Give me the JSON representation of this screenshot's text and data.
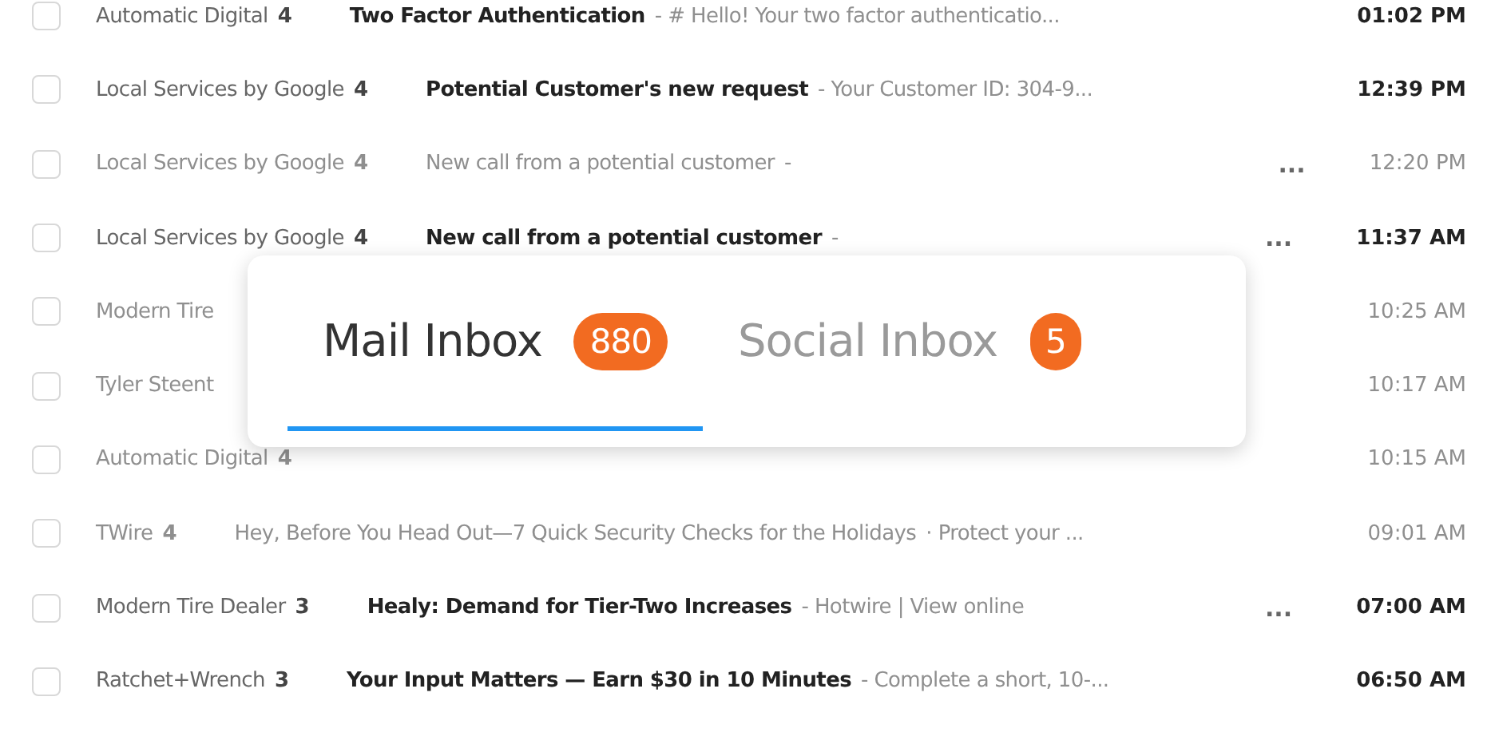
{
  "messages": [
    {
      "sender": "Automatic Digital",
      "count": "4",
      "subject": "Two Factor Authentication",
      "snippet": "- # Hello! Your two factor authenticatio...",
      "time": "01:02 PM",
      "unread": true,
      "checked": false
    },
    {
      "sender": "Local Services by Google",
      "count": "4",
      "subject": "Potential Customer's new request",
      "snippet": "- Your Customer ID: 304-9...",
      "time": "12:39 PM",
      "unread": true,
      "checked": false
    },
    {
      "sender": "Local Services by Google",
      "count": "4",
      "subject": "New call from a potential customer",
      "snippet": "-",
      "more": "...",
      "time": "12:20 PM",
      "unread": false,
      "checked": false
    },
    {
      "sender": "Local Services by Google",
      "count": "4",
      "subject": "New call from a potential customer",
      "snippet": "-",
      "more": "...",
      "time": "11:37 AM",
      "unread": true,
      "checked": false
    },
    {
      "sender": "Modern Tire",
      "time": "10:25 AM",
      "unread": false,
      "checked": false
    },
    {
      "sender": "Tyler Steent",
      "time": "10:17 AM",
      "unread": false,
      "checked": false
    },
    {
      "sender": "Automatic Digital",
      "count": "4",
      "time": "10:15 AM",
      "unread": false,
      "checked": false
    },
    {
      "sender": "TWire",
      "count": "4",
      "subject": "Hey, Before You Head Out—7 Quick Security Checks for the Holidays",
      "snippet": "· Protect your ...",
      "time": "09:01 AM",
      "unread": false,
      "checked": false
    },
    {
      "sender": "Modern Tire Dealer",
      "count": "3",
      "subject": "Healy: Demand for Tier-Two Increases",
      "snippet": "- Hotwire | View online",
      "more": "...",
      "time": "07:00 AM",
      "unread": true,
      "checked": false
    },
    {
      "sender": "Ratchet+Wrench",
      "count": "3",
      "subject": "Your Input Matters — Earn $30 in 10 Minutes",
      "snippet": "- Complete a short, 10-...",
      "time": "06:50 AM",
      "unread": true,
      "checked": false
    }
  ],
  "tabs": [
    {
      "label": "Mail Inbox",
      "badge": "880",
      "selected": true
    },
    {
      "label": "Social Inbox",
      "badge": "5",
      "selected": false
    }
  ]
}
